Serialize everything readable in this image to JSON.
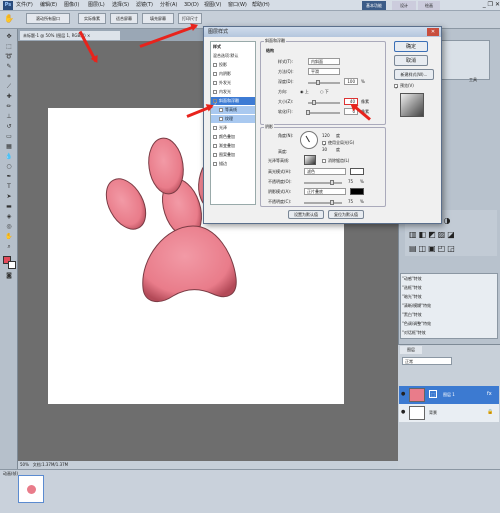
{
  "app": {
    "logo": "Ps",
    "title": "Adobe Photoshop CS5"
  },
  "menu": [
    "文件(F)",
    "编辑(E)",
    "图像(I)",
    "图层(L)",
    "选择(S)",
    "滤镜(T)",
    "分析(A)",
    "3D(D)",
    "视图(V)",
    "窗口(W)",
    "帮助(H)"
  ],
  "workspace": {
    "essentials": "基本功能",
    "btn1": "设计",
    "btn2": "绘画",
    "controls": "_ ❐ ✕"
  },
  "options": {
    "buttons": [
      "滚动所有窗口",
      "实际像素",
      "适合屏幕",
      "填充屏幕",
      "打印尺寸"
    ]
  },
  "document": {
    "tab": "未标题-1 @ 50% (图层 1, RGB/8) ×",
    "status_zoom": "50%",
    "status_doc": "文档:1.37M/1.37M"
  },
  "dialog": {
    "title": "图层样式",
    "close": "✕",
    "styles_header": "样式",
    "styles": [
      "混合选项:默认",
      "投影",
      "内阴影",
      "外发光",
      "内发光",
      "斜面和浮雕",
      "等高线",
      "纹理",
      "光泽",
      "颜色叠加",
      "渐变叠加",
      "图案叠加",
      "描边"
    ],
    "structure": {
      "group": "斜面和浮雕",
      "sub": "结构",
      "style_label": "样式(T):",
      "style_value": "内斜面",
      "method_label": "方法(Q):",
      "method_value": "平滑",
      "depth_label": "深度(D):",
      "depth_value": "100",
      "depth_unit": "%",
      "dir_label": "方向:",
      "dir_up": "上",
      "dir_down": "下",
      "size_label": "大小(Z):",
      "size_value": "40",
      "size_unit": "像素",
      "soften_label": "软化(F):",
      "soften_value": "0",
      "soften_unit": "像素"
    },
    "shading": {
      "group": "阴影",
      "angle_label": "角度(N):",
      "angle_value": "120",
      "angle_unit": "度",
      "global_light": "使用全局光(G)",
      "altitude_label": "高度:",
      "altitude_value": "30",
      "altitude_unit": "度",
      "gloss_label": "光泽等高线:",
      "antialias": "消除锯齿(L)",
      "hl_mode_label": "高光模式(H):",
      "hl_mode": "滤色",
      "hl_opacity_label": "不透明度(O):",
      "hl_opacity": "75",
      "pct": "%",
      "sh_mode_label": "阴影模式(A):",
      "sh_mode": "正片叠底",
      "sh_opacity_label": "不透明度(C):",
      "sh_opacity": "75"
    },
    "default_btn": "设置为默认值",
    "reset_btn": "复位为默认值",
    "ok": "确定",
    "cancel": "取消",
    "new_style": "新建样式(W)...",
    "preview": "预览(V)"
  },
  "panels": {
    "nav_tab": "工具",
    "styles_rows": [
      "\"动感\"特效",
      "\"选框\"特效",
      "\"暗光\"特效",
      "\"清晰/模糊\"特效",
      "\"黑白\"特效",
      "\"色调/调整\"特效",
      "\"对话框\"特效"
    ],
    "layers_tab": "图层",
    "blend": "正常",
    "layer1": "图层 1",
    "layer_bg": "背景"
  },
  "filmstrip": {
    "label": "动画(帧)"
  },
  "colors": {
    "paw": "#e97c8a",
    "accent": "#3d7bd4",
    "arrow": "#e8231c"
  }
}
